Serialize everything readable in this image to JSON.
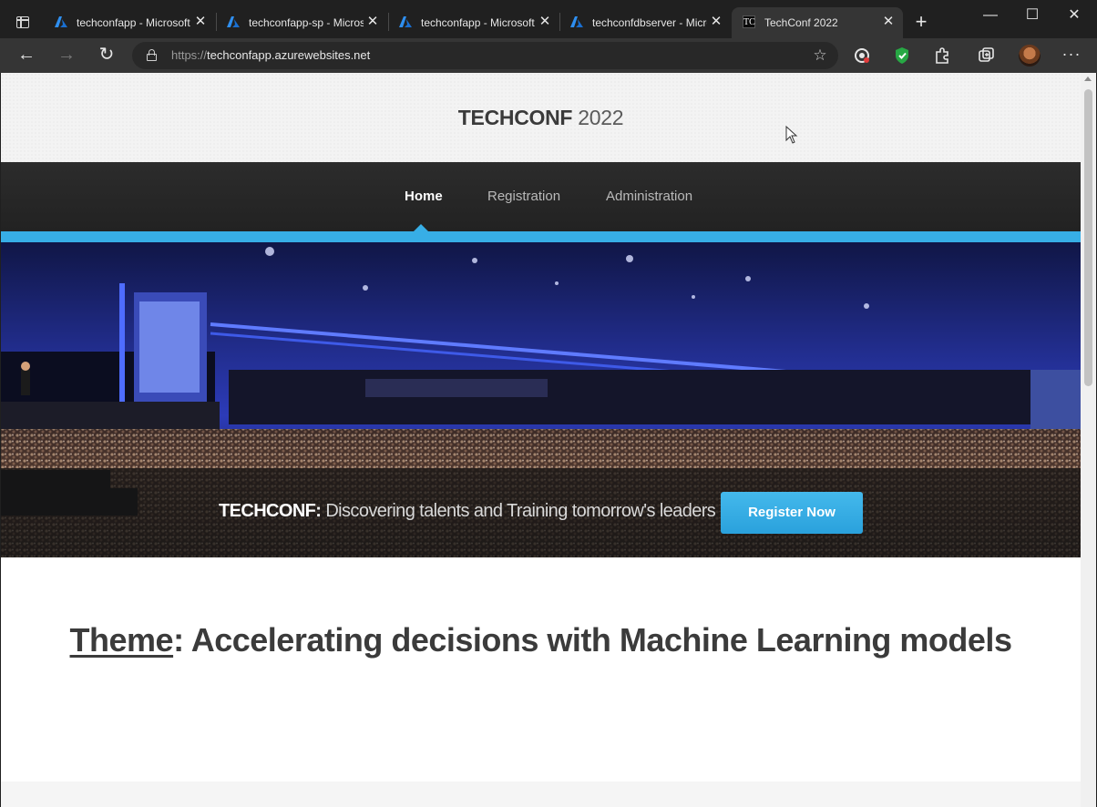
{
  "browser": {
    "tabs": [
      {
        "title": "techconfapp - Microsoft Azure",
        "favicon": "azure-icon",
        "active": false
      },
      {
        "title": "techconfapp-sp - Microsoft Azure",
        "favicon": "azure-icon",
        "active": false
      },
      {
        "title": "techconfapp - Microsoft Azure",
        "favicon": "azure-icon",
        "active": false
      },
      {
        "title": "techconfdbserver - Microsoft Azure",
        "favicon": "azure-icon",
        "active": false
      },
      {
        "title": "TechConf 2022",
        "favicon": "tc-icon",
        "favicon_text": "TC",
        "active": true
      }
    ],
    "close_glyph": "✕",
    "new_tab_glyph": "+",
    "window_controls": {
      "minimize": "—",
      "maximize": "☐",
      "close": "✕"
    },
    "address": {
      "scheme": "https://",
      "host": "techconfapp.azurewebsites.net"
    },
    "nav": {
      "back": "←",
      "forward": "→",
      "refresh": "↻"
    },
    "more_glyph": "···"
  },
  "site": {
    "logo_strong": "TECHCONF",
    "logo_light": " 2022",
    "nav_items": [
      {
        "label": "Home",
        "active": true
      },
      {
        "label": "Registration",
        "active": false
      },
      {
        "label": "Administration",
        "active": false
      }
    ],
    "hero": {
      "brand": "TECHCONF:",
      "tagline": " Discovering talents and Training tomorrow's leaders",
      "cta": "Register Now"
    },
    "theme": {
      "label": "Theme",
      "text": ": Accelerating decisions with Machine Learning models"
    }
  },
  "colors": {
    "accent": "#37aee6",
    "nav_bg": "#2a2a2a",
    "browser_bg": "#202020",
    "toolbar_bg": "#353535"
  }
}
